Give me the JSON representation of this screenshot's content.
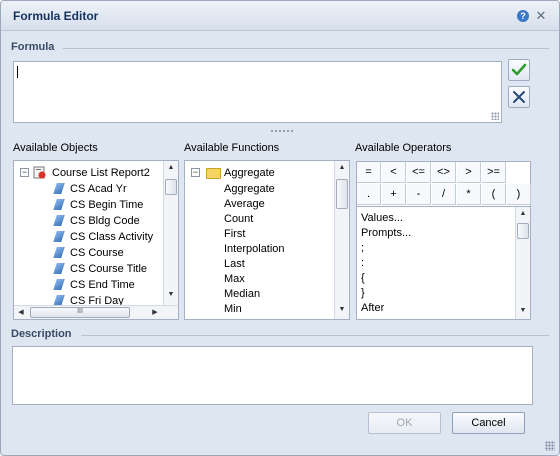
{
  "window": {
    "title": "Formula Editor",
    "help_icon": "help-icon",
    "close_icon": "close-icon",
    "help_glyph": "?",
    "close_glyph": "✕"
  },
  "formula": {
    "label": "Formula",
    "value": "",
    "validate_icon": "checkmark-icon",
    "clear_icon": "x-clear-icon",
    "accent": "#2e9b2e"
  },
  "objects": {
    "label": "Available Objects",
    "root": "Course List Report2",
    "items": [
      "CS Acad Yr",
      "CS Begin Time",
      "CS Bldg Code",
      "CS Class Activity",
      "CS Course",
      "CS Course Title",
      "CS End Time",
      "CS Fri Day"
    ],
    "hscroll_thumb": "III"
  },
  "functions": {
    "label": "Available Functions",
    "folder": "Aggregate",
    "items": [
      "Aggregate",
      "Average",
      "Count",
      "First",
      "Interpolation",
      "Last",
      "Max",
      "Median",
      "Min"
    ]
  },
  "operators": {
    "label": "Available Operators",
    "grid_row1": [
      "=",
      "<",
      "<=",
      "<>",
      ">",
      ">="
    ],
    "grid_row2": [
      ".",
      "+",
      "-",
      "/",
      "*",
      "(",
      ")"
    ],
    "list": [
      "Values...",
      "Prompts...",
      ";",
      ":",
      "{",
      "}",
      "After"
    ]
  },
  "description": {
    "label": "Description",
    "value": ""
  },
  "buttons": {
    "ok": "OK",
    "cancel": "Cancel"
  },
  "scroll_glyphs": {
    "up": "▲",
    "down": "▼",
    "left": "◀",
    "right": "▶"
  },
  "tree_glyphs": {
    "collapse": "−"
  }
}
